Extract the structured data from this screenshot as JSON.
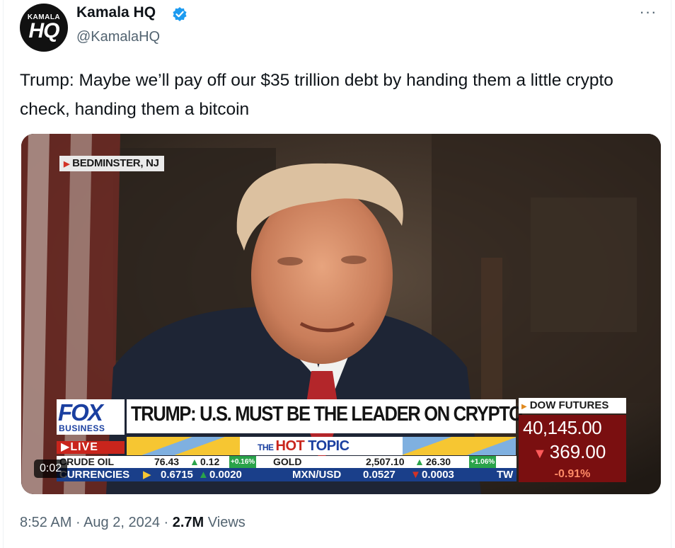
{
  "author": {
    "avatar_small": "KAMALA",
    "avatar_big": "HQ",
    "name": "Kamala HQ",
    "handle": "@KamalaHQ",
    "verified_color": "#1d9bf0"
  },
  "more_icon": "···",
  "tweet": {
    "text": "Trump: Maybe we’ll pay off our $35 trillion debt by handing them a little crypto check, handing them a bitcoin"
  },
  "video": {
    "location": "BEDMINSTER, NJ",
    "network": "FOX",
    "network_sub": "BUSINESS",
    "live": "LIVE",
    "headline": "TRUMP: U.S. MUST BE THE LEADER ON CRYPTO",
    "hot_the": "THE",
    "hot_hot": "HOT",
    "hot_topic": "TOPIC",
    "ticker1": {
      "label": "CRUDE OIL",
      "value": "76.43",
      "change": "0.12",
      "pct": "+0.16%",
      "label2": "GOLD",
      "value2": "2,507.10",
      "change2": "26.30",
      "pct2": "+1.06%"
    },
    "ticker2": {
      "label": "CURRENCIES",
      "value": "0.6715",
      "change": "0.0020",
      "label2": "MXN/USD",
      "value2": "0.0527",
      "change2": "0.0003",
      "tail": "TW"
    },
    "dow": {
      "title": "DOW FUTURES",
      "value": "40,145.00",
      "change": "369.00",
      "pct": "-0.91%"
    },
    "timer": "0:02"
  },
  "meta": {
    "time": "8:52 AM",
    "dot": "·",
    "date": "Aug 2, 2024",
    "views_count": "2.7M",
    "views_label": "Views"
  }
}
